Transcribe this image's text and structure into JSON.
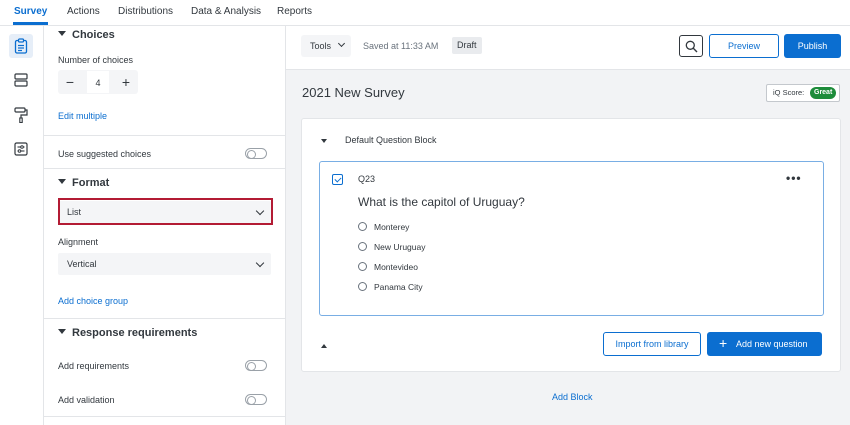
{
  "topnav": {
    "tabs": [
      {
        "label": "Survey",
        "active": true
      },
      {
        "label": "Actions",
        "active": false
      },
      {
        "label": "Distributions",
        "active": false
      },
      {
        "label": "Data & Analysis",
        "active": false
      },
      {
        "label": "Reports",
        "active": false
      }
    ]
  },
  "rail": {
    "icons": [
      "survey-clipboard-icon",
      "blocks-icon",
      "paint-roller-icon",
      "survey-options-icon"
    ]
  },
  "panel": {
    "choices": {
      "heading": "Choices",
      "number_label": "Number of choices",
      "decrement": "−",
      "count": "4",
      "increment": "+",
      "edit_multiple": "Edit multiple",
      "suggested_label": "Use suggested choices"
    },
    "format": {
      "heading": "Format",
      "format_value": "List",
      "alignment_label": "Alignment",
      "alignment_value": "Vertical",
      "add_choice_group": "Add choice group"
    },
    "response": {
      "heading": "Response requirements",
      "add_requirements": "Add requirements",
      "add_validation": "Add validation"
    }
  },
  "toolbar": {
    "tools_label": "Tools",
    "saved_text": "Saved at 11:33 AM",
    "draft_badge": "Draft",
    "preview_label": "Preview",
    "publish_label": "Publish"
  },
  "survey": {
    "title": "2021 New Survey",
    "iq_label": "iQ Score:",
    "iq_value": "Great",
    "block_name": "Default Question Block",
    "question": {
      "id": "Q23",
      "more": "•••",
      "text": "What is the capitol of Uruguay?",
      "choices": [
        "Monterey",
        "New Uruguay",
        "Montevideo",
        "Panama City"
      ]
    },
    "import_label": "Import from library",
    "add_question_label": "Add new question",
    "add_block_label": "Add Block"
  },
  "colors": {
    "accent": "#0b6ed0",
    "highlight": "#b31b34",
    "great": "#1d8c3a"
  }
}
